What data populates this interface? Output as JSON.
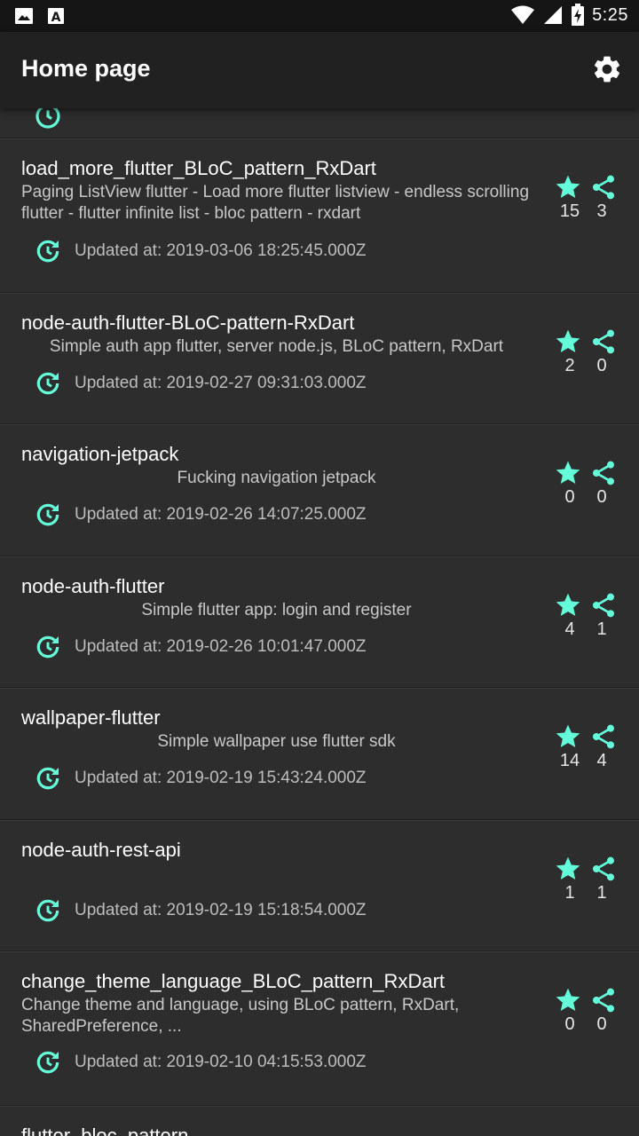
{
  "status_bar": {
    "time": "5:25",
    "icons": [
      "image-icon",
      "text-a-icon",
      "wifi-icon",
      "signal-icon",
      "battery-charging-icon"
    ]
  },
  "app_bar": {
    "title": "Home page",
    "settings_icon": "gear-icon"
  },
  "colors": {
    "accent": "#64ffda",
    "background": "#303030",
    "card": "#2d2d2d",
    "app_bar": "#212121"
  },
  "updated_prefix": "Updated at:",
  "repos": [
    {
      "title": "load_more_flutter_BLoC_pattern_RxDart",
      "description": "Paging ListView flutter - Load more flutter listview - endless scrolling flutter - flutter infinite list - bloc pattern - rxdart",
      "updated_text": "Updated at: 2019-03-06 18:25:45.000Z",
      "stars": "15",
      "forks": "3"
    },
    {
      "title": "node-auth-flutter-BLoC-pattern-RxDart",
      "description": "Simple auth app flutter, server node.js, BLoC pattern, RxDart",
      "updated_text": "Updated at: 2019-02-27 09:31:03.000Z",
      "stars": "2",
      "forks": "0"
    },
    {
      "title": "navigation-jetpack",
      "description": "Fucking navigation jetpack",
      "updated_text": "Updated at: 2019-02-26 14:07:25.000Z",
      "stars": "0",
      "forks": "0"
    },
    {
      "title": "node-auth-flutter",
      "description": "Simple flutter app: login and register",
      "updated_text": "Updated at: 2019-02-26 10:01:47.000Z",
      "stars": "4",
      "forks": "1"
    },
    {
      "title": "wallpaper-flutter",
      "description": "Simple wallpaper use flutter sdk",
      "updated_text": "Updated at: 2019-02-19 15:43:24.000Z",
      "stars": "14",
      "forks": "4"
    },
    {
      "title": "node-auth-rest-api",
      "description": "",
      "updated_text": "Updated at: 2019-02-19 15:18:54.000Z",
      "stars": "1",
      "forks": "1"
    },
    {
      "title": "change_theme_language_BLoC_pattern_RxDart",
      "description": "Change theme and language, using BLoC pattern, RxDart, SharedPreference, ...",
      "updated_text": "Updated at: 2019-02-10 04:15:53.000Z",
      "stars": "0",
      "forks": "0"
    },
    {
      "title": "flutter_bloc_pattern",
      "description": "",
      "updated_text": "",
      "stars": "",
      "forks": ""
    }
  ]
}
